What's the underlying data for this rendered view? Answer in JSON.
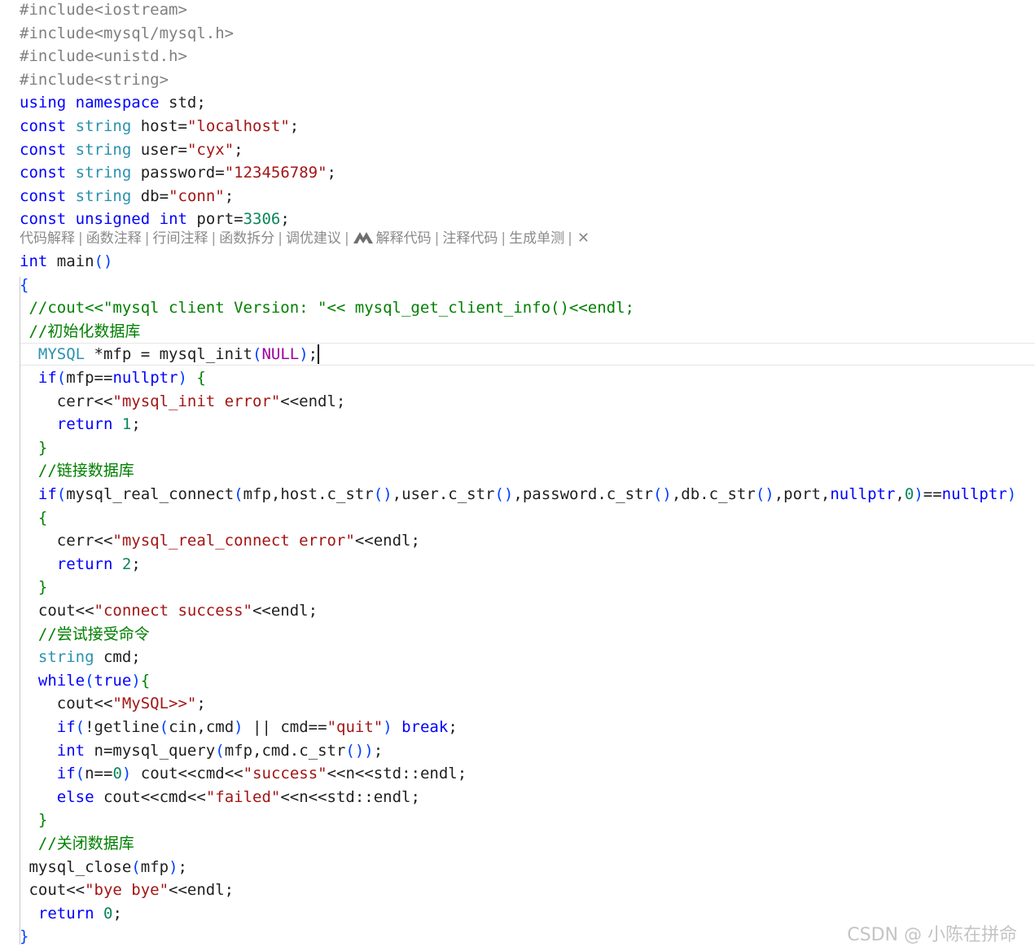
{
  "editor": {
    "language": "cpp",
    "colors": {
      "keyword": "#0000ff",
      "type": "#2b91af",
      "string": "#a31515",
      "comment": "#008000",
      "preprocessor": "#808080",
      "number": "#098658",
      "macro": "#a000a0",
      "plain": "#1f1f1f"
    },
    "lines": [
      [
        [
          "pre",
          "#include<iostream>"
        ]
      ],
      [
        [
          "pre",
          "#include<mysql/mysql.h>"
        ]
      ],
      [
        [
          "pre",
          "#include<unistd.h>"
        ]
      ],
      [
        [
          "pre",
          "#include<string>"
        ]
      ],
      [
        [
          "kw",
          "using"
        ],
        [
          "plain",
          " "
        ],
        [
          "kw",
          "namespace"
        ],
        [
          "plain",
          " std;"
        ]
      ],
      [
        [
          "kw",
          "const"
        ],
        [
          "plain",
          " "
        ],
        [
          "type",
          "string"
        ],
        [
          "plain",
          " host="
        ],
        [
          "str",
          "\"localhost\""
        ],
        [
          "plain",
          ";"
        ]
      ],
      [
        [
          "kw",
          "const"
        ],
        [
          "plain",
          " "
        ],
        [
          "type",
          "string"
        ],
        [
          "plain",
          " user="
        ],
        [
          "str",
          "\"cyx\""
        ],
        [
          "plain",
          ";"
        ]
      ],
      [
        [
          "kw",
          "const"
        ],
        [
          "plain",
          " "
        ],
        [
          "type",
          "string"
        ],
        [
          "plain",
          " password="
        ],
        [
          "str",
          "\"123456789\""
        ],
        [
          "plain",
          ";"
        ]
      ],
      [
        [
          "kw",
          "const"
        ],
        [
          "plain",
          " "
        ],
        [
          "type",
          "string"
        ],
        [
          "plain",
          " db="
        ],
        [
          "str",
          "\"conn\""
        ],
        [
          "plain",
          ";"
        ]
      ],
      [
        [
          "kw",
          "const"
        ],
        [
          "plain",
          " "
        ],
        [
          "kw",
          "unsigned"
        ],
        [
          "plain",
          " "
        ],
        [
          "kw",
          "int"
        ],
        [
          "plain",
          " port="
        ],
        [
          "num",
          "3306"
        ],
        [
          "plain",
          ";"
        ]
      ],
      [
        [
          "kw",
          "int"
        ],
        [
          "plain",
          " main"
        ],
        [
          "paren",
          "()"
        ]
      ],
      [
        [
          "paren",
          "{"
        ]
      ],
      [
        [
          "com",
          " //cout<<\"mysql client Version: \"<< mysql_get_client_info()<<endl;"
        ]
      ],
      [
        [
          "com",
          " //初始化数据库"
        ]
      ],
      [
        [
          "plain",
          "  "
        ],
        [
          "type",
          "MYSQL"
        ],
        [
          "plain",
          " *mfp = mysql_init"
        ],
        [
          "paren",
          "("
        ],
        [
          "macro",
          "NULL"
        ],
        [
          "paren",
          ")"
        ],
        [
          "plain",
          ";"
        ]
      ],
      [
        [
          "plain",
          "  "
        ],
        [
          "kw",
          "if"
        ],
        [
          "paren",
          "("
        ],
        [
          "plain",
          "mfp=="
        ],
        [
          "kw",
          "nullptr"
        ],
        [
          "paren",
          ")"
        ],
        [
          "plain",
          " "
        ],
        [
          "com",
          "{"
        ]
      ],
      [
        [
          "plain",
          "    cerr<<"
        ],
        [
          "str",
          "\"mysql_init error\""
        ],
        [
          "plain",
          "<<endl;"
        ]
      ],
      [
        [
          "plain",
          "    "
        ],
        [
          "kw",
          "return"
        ],
        [
          "plain",
          " "
        ],
        [
          "num",
          "1"
        ],
        [
          "plain",
          ";"
        ]
      ],
      [
        [
          "plain",
          "  "
        ],
        [
          "com",
          "}"
        ]
      ],
      [
        [
          "com",
          "  //链接数据库"
        ]
      ],
      [
        [
          "plain",
          "  "
        ],
        [
          "kw",
          "if"
        ],
        [
          "paren",
          "("
        ],
        [
          "plain",
          "mysql_real_connect"
        ],
        [
          "paren",
          "("
        ],
        [
          "plain",
          "mfp,host.c_str"
        ],
        [
          "paren",
          "()"
        ],
        [
          "plain",
          ",user.c_str"
        ],
        [
          "paren",
          "()"
        ],
        [
          "plain",
          ",password.c_str"
        ],
        [
          "paren",
          "()"
        ],
        [
          "plain",
          ",db.c_str"
        ],
        [
          "paren",
          "()"
        ],
        [
          "plain",
          ",port,"
        ],
        [
          "kw",
          "nullptr"
        ],
        [
          "plain",
          ","
        ],
        [
          "num",
          "0"
        ],
        [
          "paren",
          ")"
        ],
        [
          "plain",
          "=="
        ],
        [
          "kw",
          "nullptr"
        ],
        [
          "paren",
          ")"
        ]
      ],
      [
        [
          "plain",
          "  "
        ],
        [
          "com",
          "{"
        ]
      ],
      [
        [
          "plain",
          "    cerr<<"
        ],
        [
          "str",
          "\"mysql_real_connect error\""
        ],
        [
          "plain",
          "<<endl;"
        ]
      ],
      [
        [
          "plain",
          "    "
        ],
        [
          "kw",
          "return"
        ],
        [
          "plain",
          " "
        ],
        [
          "num",
          "2"
        ],
        [
          "plain",
          ";"
        ]
      ],
      [
        [
          "plain",
          "  "
        ],
        [
          "com",
          "}"
        ]
      ],
      [
        [
          "plain",
          "  cout<<"
        ],
        [
          "str",
          "\"connect success\""
        ],
        [
          "plain",
          "<<endl;"
        ]
      ],
      [
        [
          "com",
          "  //尝试接受命令"
        ]
      ],
      [
        [
          "plain",
          "  "
        ],
        [
          "type",
          "string"
        ],
        [
          "plain",
          " cmd;"
        ]
      ],
      [
        [
          "plain",
          "  "
        ],
        [
          "kw",
          "while"
        ],
        [
          "paren",
          "("
        ],
        [
          "kw",
          "true"
        ],
        [
          "paren",
          ")"
        ],
        [
          "com",
          "{"
        ]
      ],
      [
        [
          "plain",
          "    cout<<"
        ],
        [
          "str",
          "\"MySQL>>\""
        ],
        [
          "plain",
          ";"
        ]
      ],
      [
        [
          "plain",
          "    "
        ],
        [
          "kw",
          "if"
        ],
        [
          "paren",
          "("
        ],
        [
          "plain",
          "!getline"
        ],
        [
          "paren",
          "("
        ],
        [
          "plain",
          "cin,cmd"
        ],
        [
          "paren",
          ")"
        ],
        [
          "plain",
          " || cmd=="
        ],
        [
          "str",
          "\"quit\""
        ],
        [
          "paren",
          ")"
        ],
        [
          "plain",
          " "
        ],
        [
          "kw",
          "break"
        ],
        [
          "plain",
          ";"
        ]
      ],
      [
        [
          "plain",
          "    "
        ],
        [
          "kw",
          "int"
        ],
        [
          "plain",
          " n=mysql_query"
        ],
        [
          "paren",
          "("
        ],
        [
          "plain",
          "mfp,cmd.c_str"
        ],
        [
          "paren",
          "())"
        ],
        [
          "plain",
          ";"
        ]
      ],
      [
        [
          "plain",
          "    "
        ],
        [
          "kw",
          "if"
        ],
        [
          "paren",
          "("
        ],
        [
          "plain",
          "n=="
        ],
        [
          "num",
          "0"
        ],
        [
          "paren",
          ")"
        ],
        [
          "plain",
          " cout<<cmd<<"
        ],
        [
          "str",
          "\"success\""
        ],
        [
          "plain",
          "<<n<<std::endl;"
        ]
      ],
      [
        [
          "plain",
          "    "
        ],
        [
          "kw",
          "else"
        ],
        [
          "plain",
          " cout<<cmd<<"
        ],
        [
          "str",
          "\"failed\""
        ],
        [
          "plain",
          "<<n<<std::endl;"
        ]
      ],
      [
        [
          "plain",
          "  "
        ],
        [
          "com",
          "}"
        ]
      ],
      [
        [
          "com",
          "  //关闭数据库"
        ]
      ],
      [
        [
          "plain",
          " mysql_close"
        ],
        [
          "paren",
          "("
        ],
        [
          "plain",
          "mfp"
        ],
        [
          "paren",
          ")"
        ],
        [
          "plain",
          ";"
        ]
      ],
      [
        [
          "plain",
          " cout<<"
        ],
        [
          "str",
          "\"bye bye\""
        ],
        [
          "plain",
          "<<endl;"
        ]
      ],
      [
        [
          "plain",
          "  "
        ],
        [
          "kw",
          "return"
        ],
        [
          "plain",
          " "
        ],
        [
          "num",
          "0"
        ],
        [
          "plain",
          ";"
        ]
      ],
      [
        [
          "paren",
          "}"
        ]
      ]
    ]
  },
  "codelens": {
    "items": [
      "代码解释",
      "函数注释",
      "行间注释",
      "函数拆分",
      "调优建议"
    ],
    "brand_items": [
      "解释代码",
      "注释代码",
      "生成单测"
    ],
    "separator": "|",
    "close_glyph": "✕",
    "brand_icon": "marscode-icon"
  },
  "watermark": {
    "text": "CSDN @ 小陈在拼命"
  }
}
